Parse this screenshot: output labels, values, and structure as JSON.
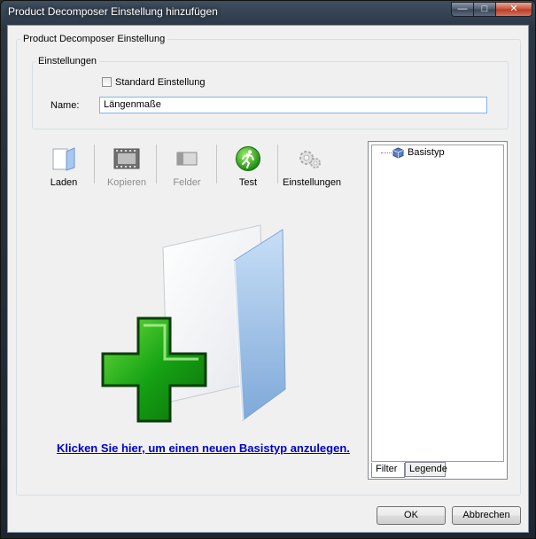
{
  "window": {
    "title": "Product Decomposer Einstellung hinzufügen",
    "minimize": "—",
    "maximize": "□",
    "close": "✕"
  },
  "outer_group": {
    "legend": "Product Decomposer Einstellung"
  },
  "settings_group": {
    "legend": "Einstellungen",
    "standard_label": "Standard Einstellung",
    "standard_checked": false,
    "name_label": "Name:",
    "name_value": "Längenmaße"
  },
  "toolbar": {
    "laden": "Laden",
    "kopieren": "Kopieren",
    "felder": "Felder",
    "test": "Test",
    "einstellungen": "Einstellungen"
  },
  "main": {
    "link": "Klicken Sie hier, um einen neuen Basistyp anzulegen."
  },
  "tree": {
    "items": [
      "Basistyp"
    ]
  },
  "tabs": [
    "Filter",
    "Legende"
  ],
  "buttons": {
    "ok": "OK",
    "cancel": "Abbrechen"
  }
}
